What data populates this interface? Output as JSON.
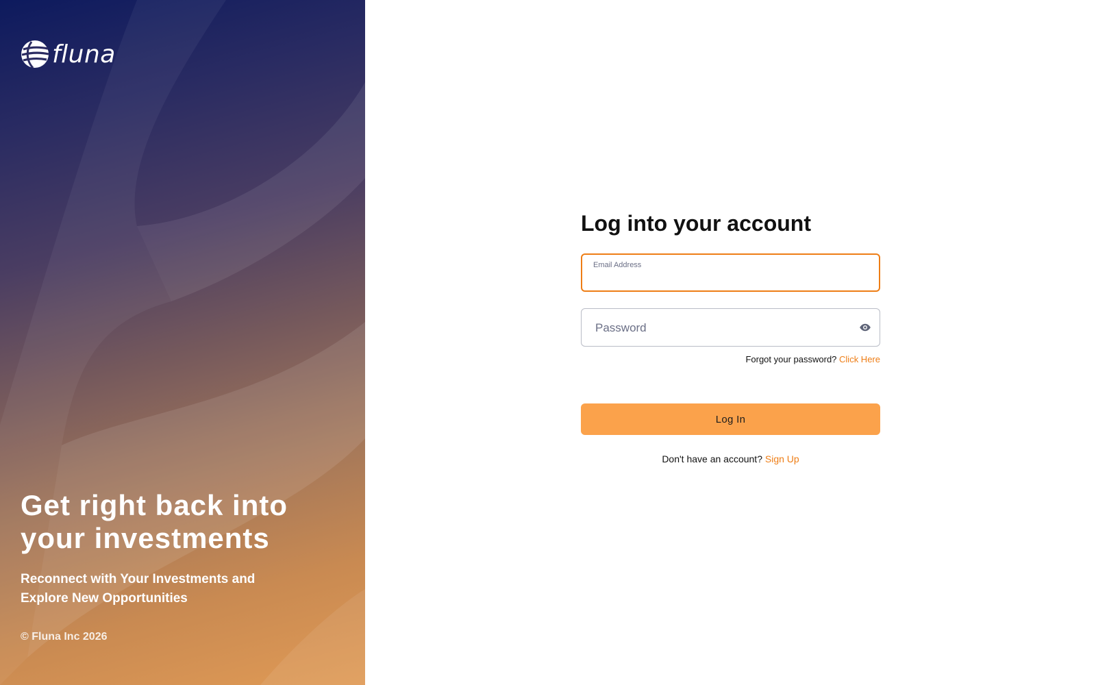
{
  "brand": {
    "name": "fluna",
    "logo_icon": "fluna-globe-logo-icon"
  },
  "hero": {
    "headline": "Get right back into your investments",
    "subheadline": "Reconnect with Your Investments and Explore New Opportunities",
    "copyright": "© Fluna Inc 2026"
  },
  "login": {
    "title": "Log into your account",
    "email": {
      "label": "Email Address",
      "value": ""
    },
    "password": {
      "placeholder": "Password",
      "value": "",
      "toggle_icon": "eye-icon"
    },
    "forgot_prompt": "Forgot your password?",
    "forgot_link": "Click Here",
    "submit_label": "Log In",
    "signup_prompt": "Don't have an account?",
    "signup_link": "Sign Up"
  },
  "colors": {
    "accent": "#ee7d15",
    "button": "#fba24b",
    "hero_top": "#0d1a5e",
    "hero_bottom": "#e09a55"
  }
}
